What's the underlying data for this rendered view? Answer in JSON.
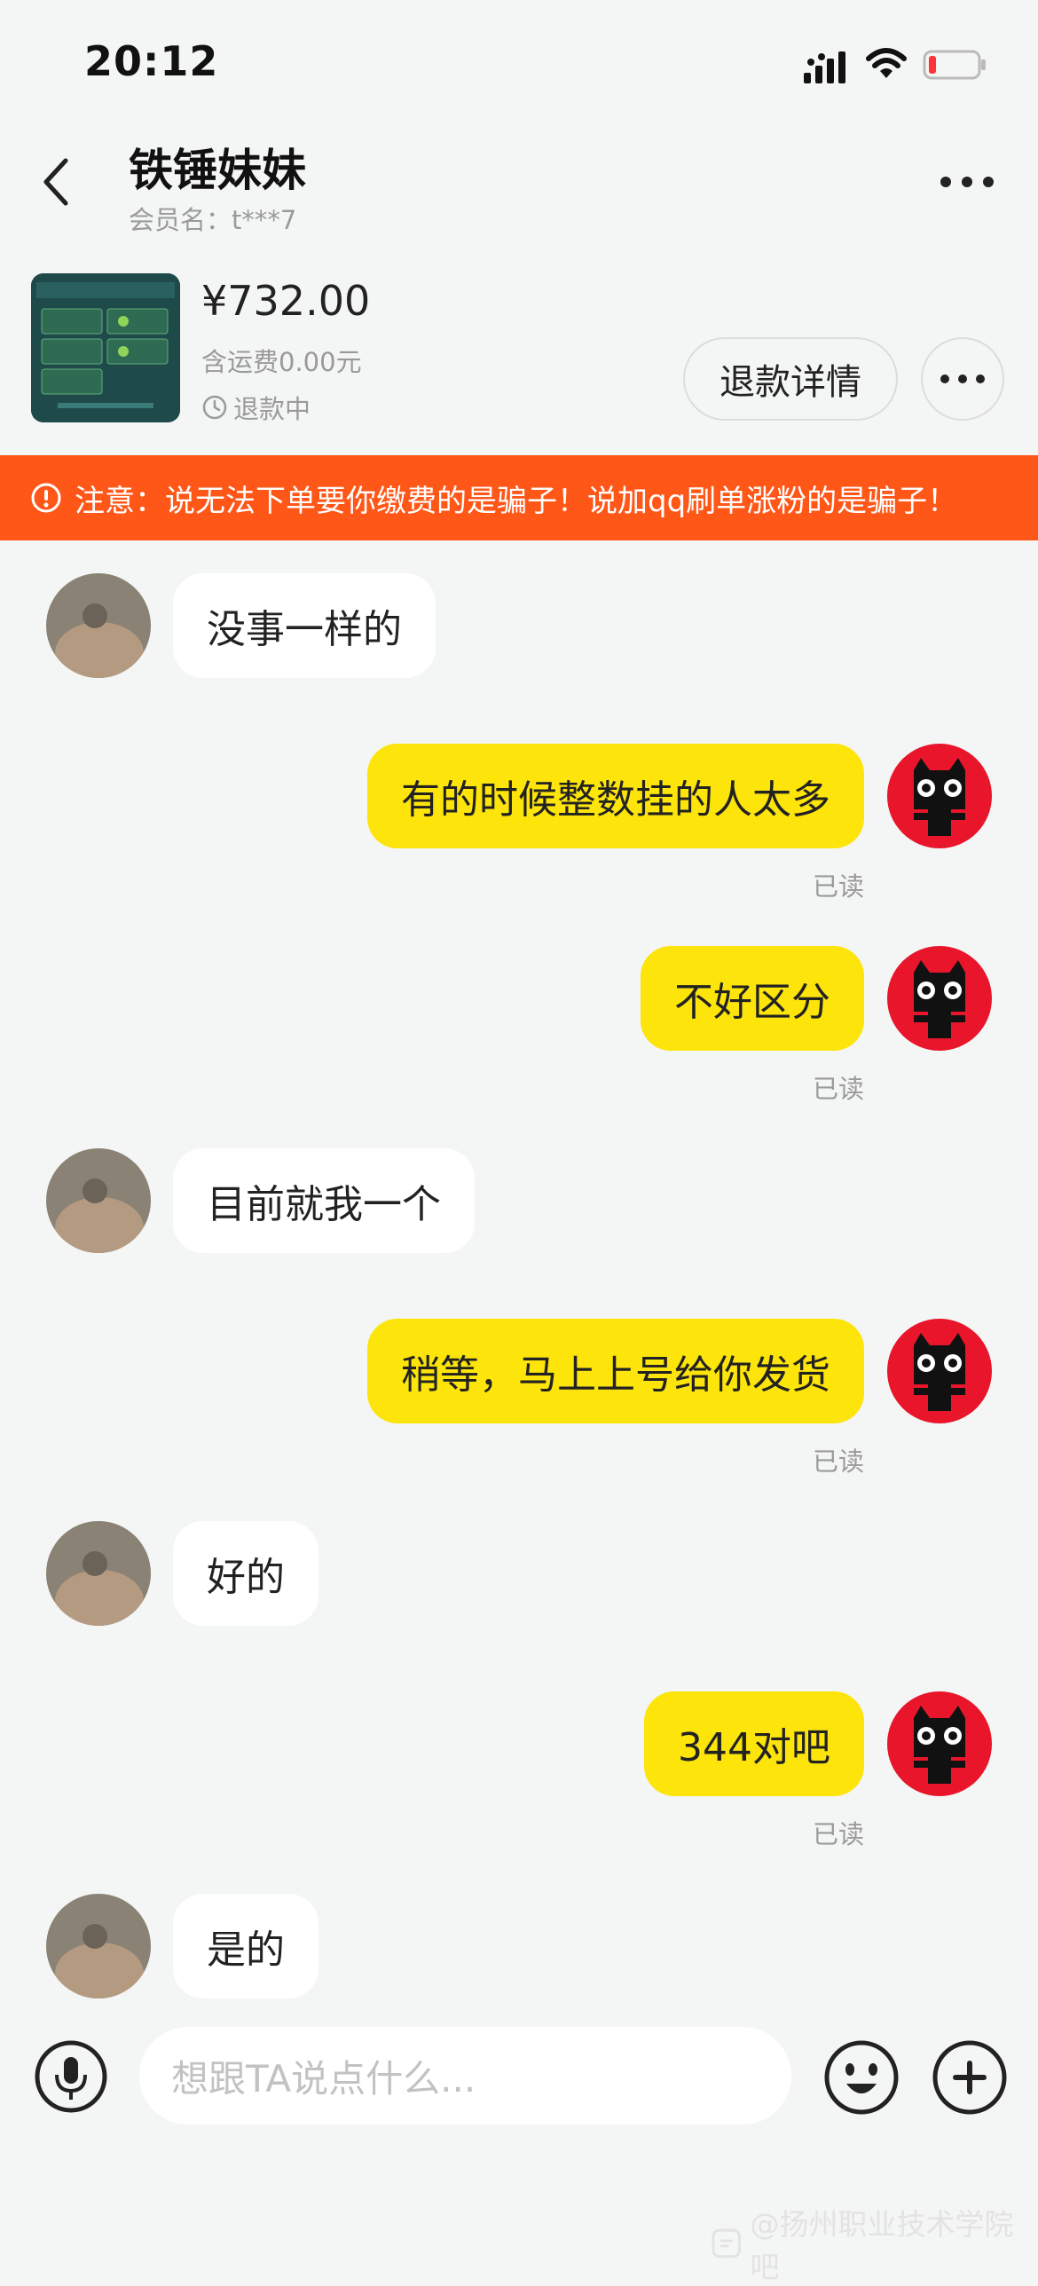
{
  "status_bar": {
    "time": "20:12"
  },
  "header": {
    "title": "铁锤妹妹",
    "subtitle": "会员名：t***7"
  },
  "product": {
    "price": "¥732.00",
    "shipping": "含运费0.00元",
    "status": "退款中",
    "refund_button": "退款详情"
  },
  "warning": {
    "text": "注意：说无法下单要你缴费的是骗子！说加qq刷单涨粉的是骗子！"
  },
  "messages": [
    {
      "side": "left",
      "text": "没事一样的"
    },
    {
      "side": "right",
      "text": "有的时候整数挂的人太多",
      "read": "已读"
    },
    {
      "side": "right",
      "text": "不好区分",
      "read": "已读"
    },
    {
      "side": "left",
      "text": "目前就我一个"
    },
    {
      "side": "right",
      "text": "稍等，马上上号给你发货",
      "read": "已读"
    },
    {
      "side": "left",
      "text": "好的"
    },
    {
      "side": "right",
      "text": "344对吧",
      "read": "已读"
    },
    {
      "side": "left",
      "text": "是的"
    }
  ],
  "input": {
    "placeholder": "想跟TA说点什么..."
  },
  "watermark": {
    "text": "@扬州职业技术学院吧"
  },
  "colors": {
    "accent_yellow": "#fde40a",
    "warning_orange": "#ff5718"
  },
  "icons": [
    "back-icon",
    "more-icon",
    "clock-icon",
    "warning-icon",
    "mic-icon",
    "emoji-icon",
    "plus-icon",
    "signal-icon",
    "wifi-icon",
    "battery-icon"
  ]
}
